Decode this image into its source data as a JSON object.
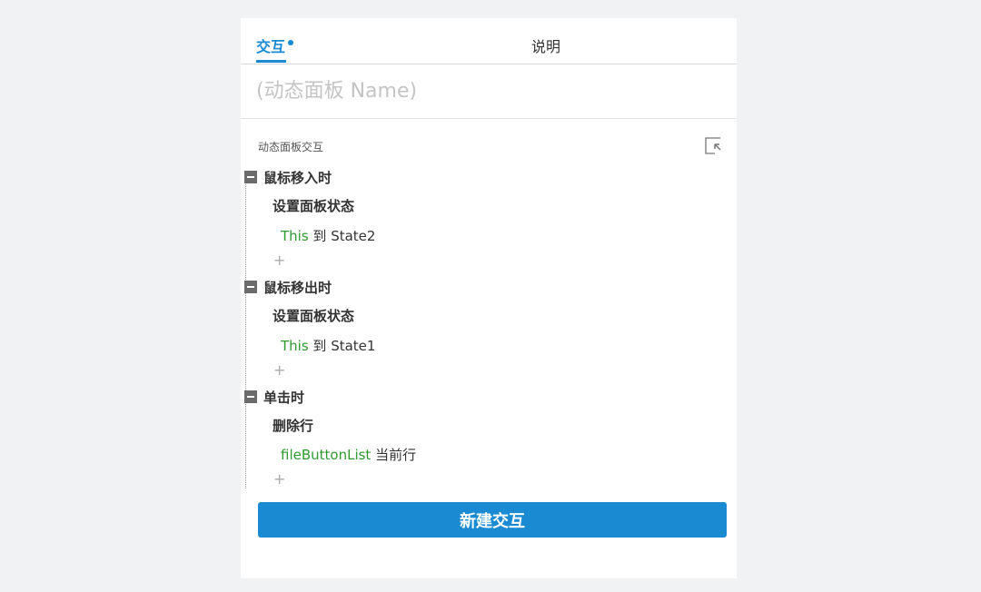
{
  "tabs": {
    "interaction": "交互",
    "notes": "说明"
  },
  "name_field": {
    "placeholder": "(动态面板 Name)",
    "value": ""
  },
  "section": {
    "title": "动态面板交互",
    "collapse_icon": "collapse-all-icon"
  },
  "events": [
    {
      "label": "鼠标移入时",
      "action": "设置面板状态",
      "target": "This",
      "detail": " 到 State2",
      "add": "+"
    },
    {
      "label": "鼠标移出时",
      "action": "设置面板状态",
      "target": "This",
      "detail": " 到 State1",
      "add": "+"
    },
    {
      "label": "单击时",
      "action": "删除行",
      "target": "fileButtonList",
      "detail": " 当前行",
      "add": "+"
    }
  ],
  "new_button": "新建交互",
  "colors": {
    "accent": "#1a8ad3",
    "target_green": "#2f9a2f",
    "background": "#f1f2f4"
  }
}
